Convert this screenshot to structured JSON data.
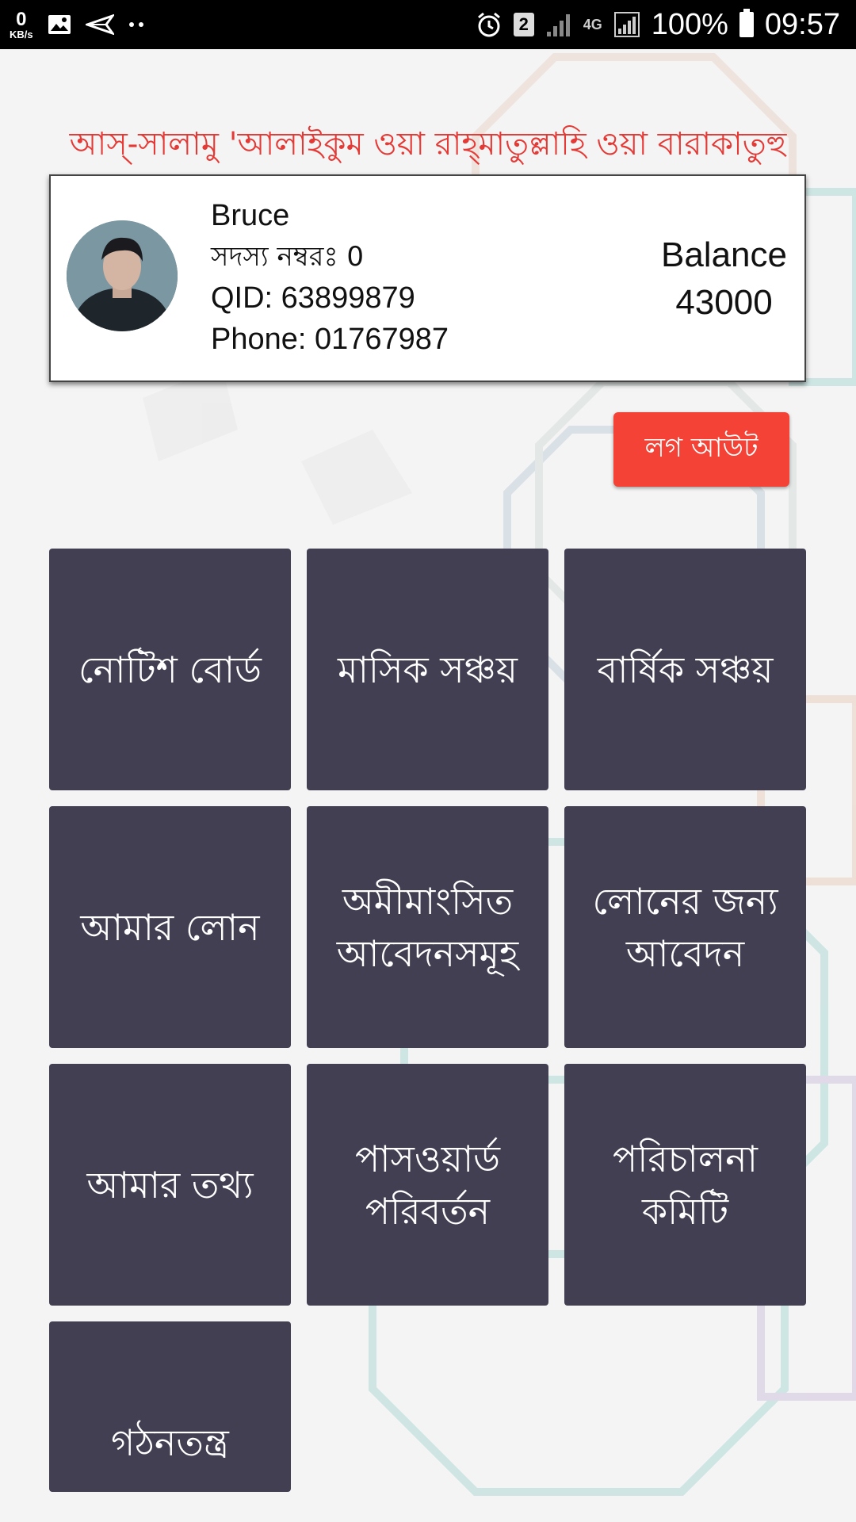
{
  "status_bar": {
    "speed_value": "0",
    "speed_unit": "KB/s",
    "notif_icons": [
      "image-icon",
      "send-icon",
      "more-dots-icon"
    ],
    "sim": "2",
    "network": "4G",
    "battery": "100%",
    "time": "09:57"
  },
  "greeting": "আস্‌-সালামু 'আলাইকুম ওয়া রাহ্‌মাতুল্লাহি ওয়া বারাকাতুহু",
  "profile": {
    "name": "Bruce",
    "member_no": "সদস্য নম্বরঃ 0",
    "qid": "QID: 63899879",
    "phone": "Phone: 01767987",
    "balance_label": "Balance",
    "balance_value": "43000"
  },
  "logout_label": "লগ আউট",
  "tiles": [
    "নোটিশ বোর্ড",
    "মাসিক সঞ্চয়",
    "বার্ষিক সঞ্চয়",
    "আমার লোন",
    "অমীমাংসিত আবেদনসমূহ",
    "লোনের জন্য আবেদন",
    "আমার তথ্য",
    "পাসওয়ার্ড পরিবর্তন",
    "পরিচালনা কমিটি",
    "গঠনতন্ত্র"
  ],
  "colors": {
    "tile_bg": "#433f52",
    "accent_red": "#f44336",
    "greeting_red": "#e53935"
  }
}
